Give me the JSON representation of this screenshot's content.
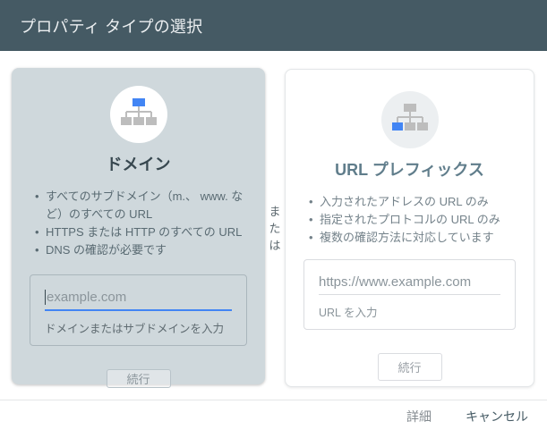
{
  "dialog": {
    "title": "プロパティ タイプの選択",
    "or_label": "または",
    "footer": {
      "details_label": "詳細",
      "cancel_label": "キャンセル"
    }
  },
  "cards": {
    "domain": {
      "title": "ドメイン",
      "icon": "sitemap-domain-icon",
      "bullets": [
        "すべてのサブドメイン（m.、 www. など）のすべての URL",
        "HTTPS または HTTP のすべての URL",
        "DNS の確認が必要です"
      ],
      "input": {
        "value": "",
        "placeholder": "example.com",
        "helper": "ドメインまたはサブドメインを入力"
      },
      "continue_label": "続行"
    },
    "url_prefix": {
      "title": "URL プレフィックス",
      "icon": "sitemap-url-prefix-icon",
      "bullets": [
        "入力されたアドレスの URL のみ",
        "指定されたプロトコルの URL のみ",
        "複数の確認方法に対応しています"
      ],
      "input": {
        "value": "",
        "placeholder": "https://www.example.com",
        "helper": "URL を入力"
      },
      "continue_label": "続行"
    }
  },
  "colors": {
    "header_bg": "#455a64",
    "selected_card_bg": "#cfd8dc",
    "accent_blue": "#4285f4",
    "icon_gray": "#bdbdbd",
    "cancel_link": "#455a64",
    "details_link": "#848b90"
  }
}
